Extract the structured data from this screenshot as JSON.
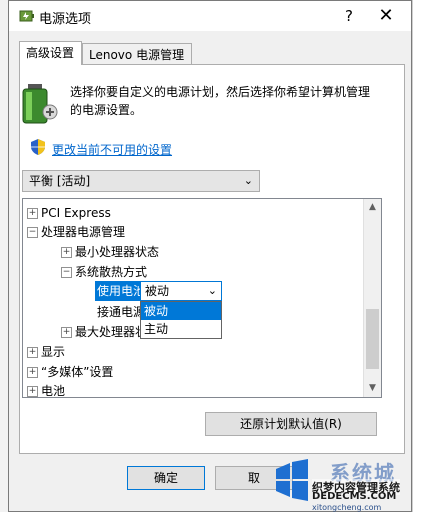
{
  "dialog": {
    "title": "电源选项",
    "help_glyph": "?",
    "close_glyph": "✕"
  },
  "tabs": [
    {
      "label": "高级设置",
      "active": true
    },
    {
      "label": "Lenovo 电源管理",
      "active": false
    }
  ],
  "intro": {
    "description": "选择你要自定义的电源计划，然后选择你希望计算机管理的电源设置。",
    "change_link": "更改当前不可用的设置"
  },
  "plan_select": {
    "value": "平衡 [活动]"
  },
  "tree": {
    "rows": [
      {
        "toggle": "+",
        "label": "PCI Express"
      },
      {
        "toggle": "−",
        "label": "处理器电源管理"
      },
      {
        "toggle": "+",
        "label": "最小处理器状态"
      },
      {
        "toggle": "−",
        "label": "系统散热方式"
      },
      {
        "label": "使用电池:"
      },
      {
        "label": "接通电源:"
      },
      {
        "toggle": "+",
        "label": "最大处理器状"
      },
      {
        "toggle": "+",
        "label": "显示"
      },
      {
        "toggle": "+",
        "label": "“多媒体”设置"
      },
      {
        "toggle": "+",
        "label": "电池"
      }
    ],
    "battery_select": {
      "value": "被动",
      "options": [
        "被动",
        "主动"
      ]
    }
  },
  "buttons": {
    "restore": "还原计划默认值(R)",
    "ok": "确定",
    "cancel": "取"
  },
  "watermark": {
    "big": "系统城",
    "line1": "织梦内容管理系统",
    "line2": "DEDECMS.COM",
    "line3": "xitongcheng.com"
  },
  "colors": {
    "accent": "#0078d7",
    "link": "#0066cc"
  }
}
